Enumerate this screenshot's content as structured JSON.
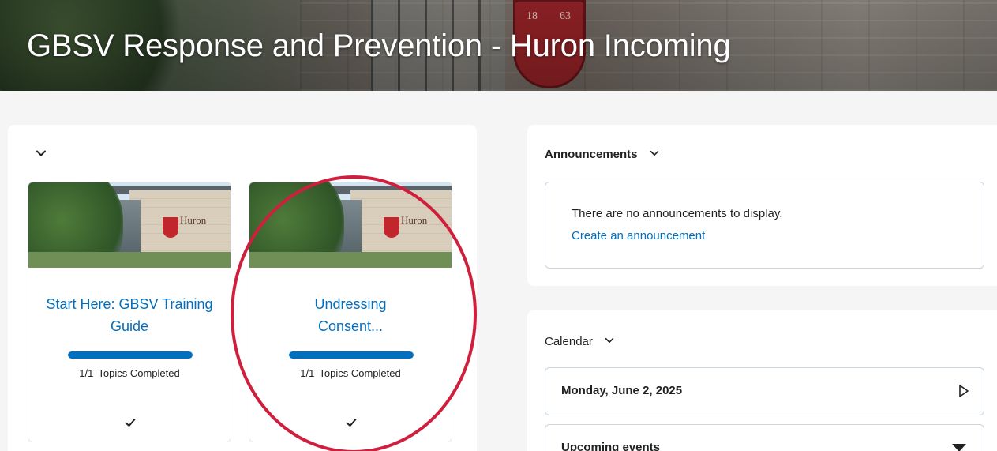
{
  "course": {
    "title": "GBSV Response and Prevention - Huron Incoming"
  },
  "banner": {
    "crest_left": "18",
    "crest_right": "63"
  },
  "content": {
    "cards": [
      {
        "title": "Start Here: GBSV Training Guide",
        "progress_fraction": 1.0,
        "count": "1/1",
        "status": "Topics Completed",
        "logo_word": "Huron"
      },
      {
        "title": "Undressing Consent...",
        "progress_fraction": 1.0,
        "count": "1/1",
        "status": "Topics Completed",
        "logo_word": "Huron"
      }
    ]
  },
  "announcements": {
    "heading": "Announcements",
    "empty_message": "There are no announcements to display.",
    "create_link": "Create an announcement"
  },
  "calendar": {
    "heading": "Calendar",
    "date": "Monday, June 2, 2025",
    "upcoming": "Upcoming events"
  },
  "colors": {
    "accent": "#006fbf",
    "annotation": "#d01f3c",
    "progress_track": "#d3d9e3"
  },
  "icons": [
    "chevron-down-icon",
    "checkmark-icon",
    "play-triangle-icon",
    "caret-down-icon"
  ]
}
